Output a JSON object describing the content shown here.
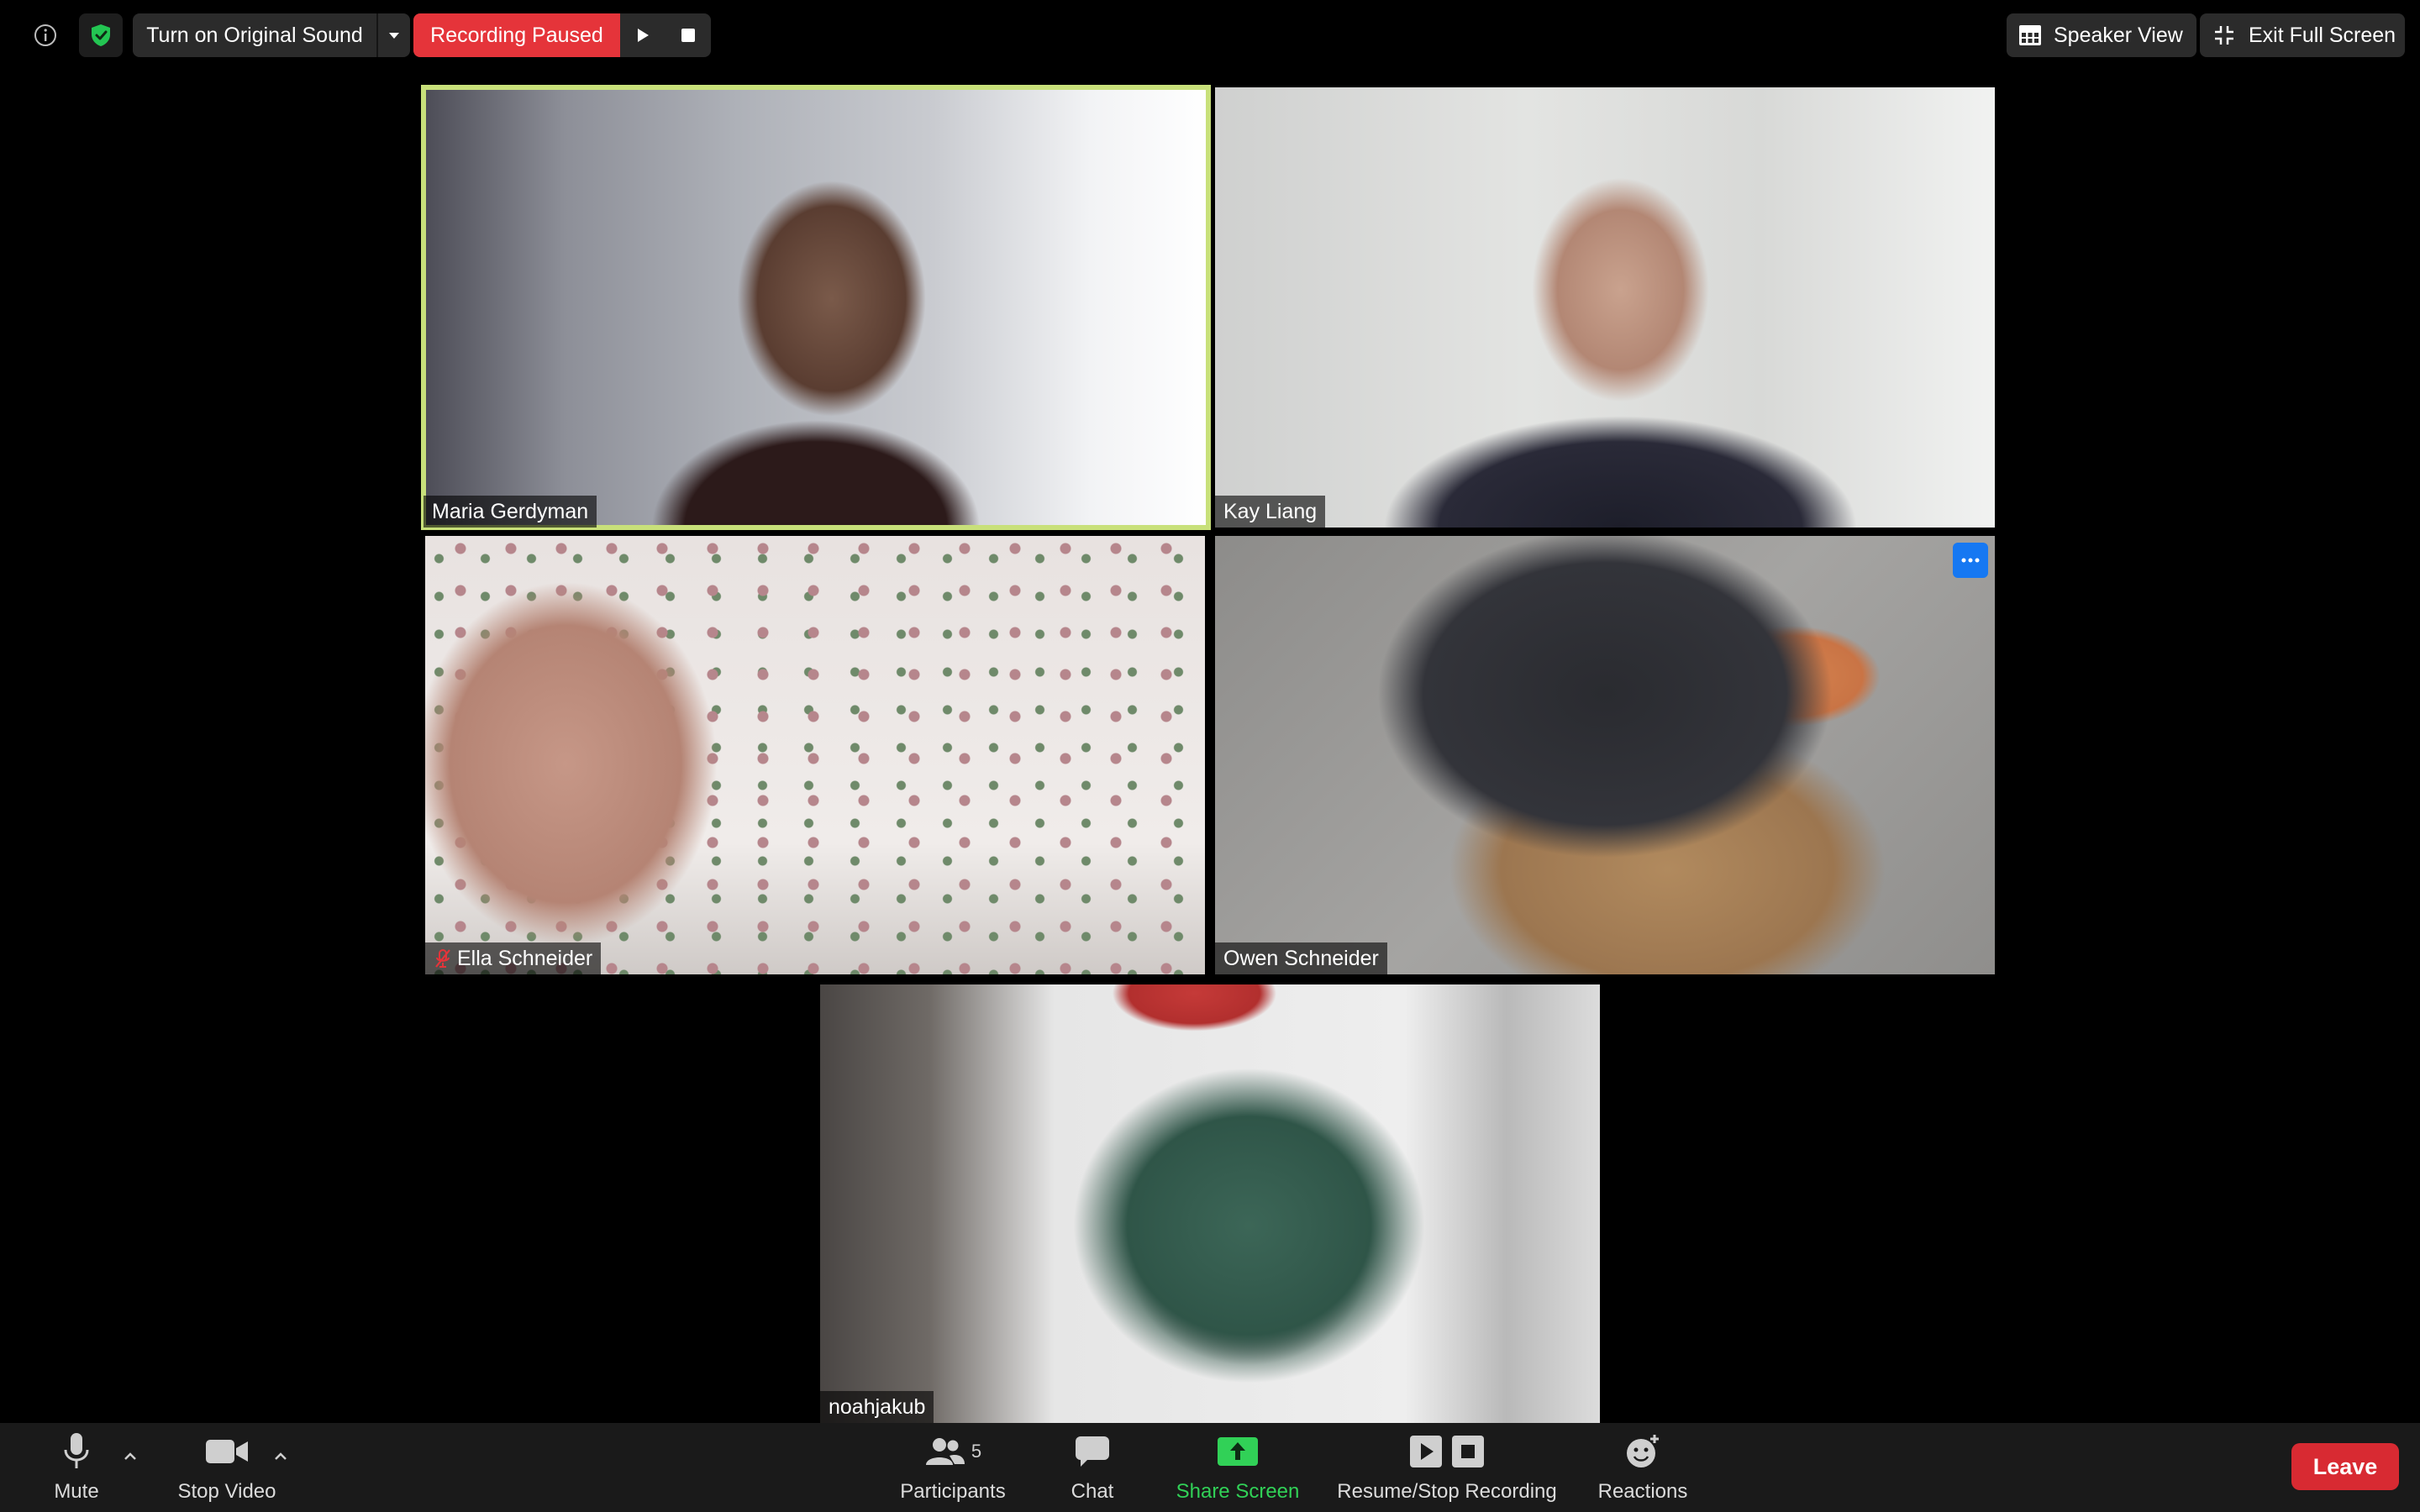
{
  "topbar": {
    "original_sound_label": "Turn on Original Sound",
    "recording_status": "Recording Paused",
    "speaker_view_label": "Speaker View",
    "exit_fullscreen_label": "Exit Full Screen",
    "icons": [
      "info-icon",
      "shield-check-icon",
      "dropdown-caret-icon",
      "play-icon",
      "stop-icon",
      "grid-icon",
      "exit-fullscreen-icon"
    ]
  },
  "participants_grid": [
    {
      "name": "Maria Gerdyman",
      "active_speaker": true,
      "muted": false
    },
    {
      "name": "Kay Liang",
      "active_speaker": false,
      "muted": false
    },
    {
      "name": "Ella Schneider",
      "active_speaker": false,
      "muted": true
    },
    {
      "name": "Owen Schneider",
      "active_speaker": false,
      "muted": false
    },
    {
      "name": "noahjakub",
      "active_speaker": false,
      "muted": false
    }
  ],
  "toolbar": {
    "mute_label": "Mute",
    "stop_video_label": "Stop Video",
    "participants_label": "Participants",
    "participants_count": "5",
    "chat_label": "Chat",
    "share_screen_label": "Share Screen",
    "recording_label": "Resume/Stop Recording",
    "reactions_label": "Reactions",
    "leave_label": "Leave"
  },
  "colors": {
    "recording_red": "#e5343a",
    "active_speaker_border": "#c8e07a",
    "share_green": "#31d157",
    "leave_red": "#d82a32",
    "more_button_blue": "#1678f2"
  }
}
